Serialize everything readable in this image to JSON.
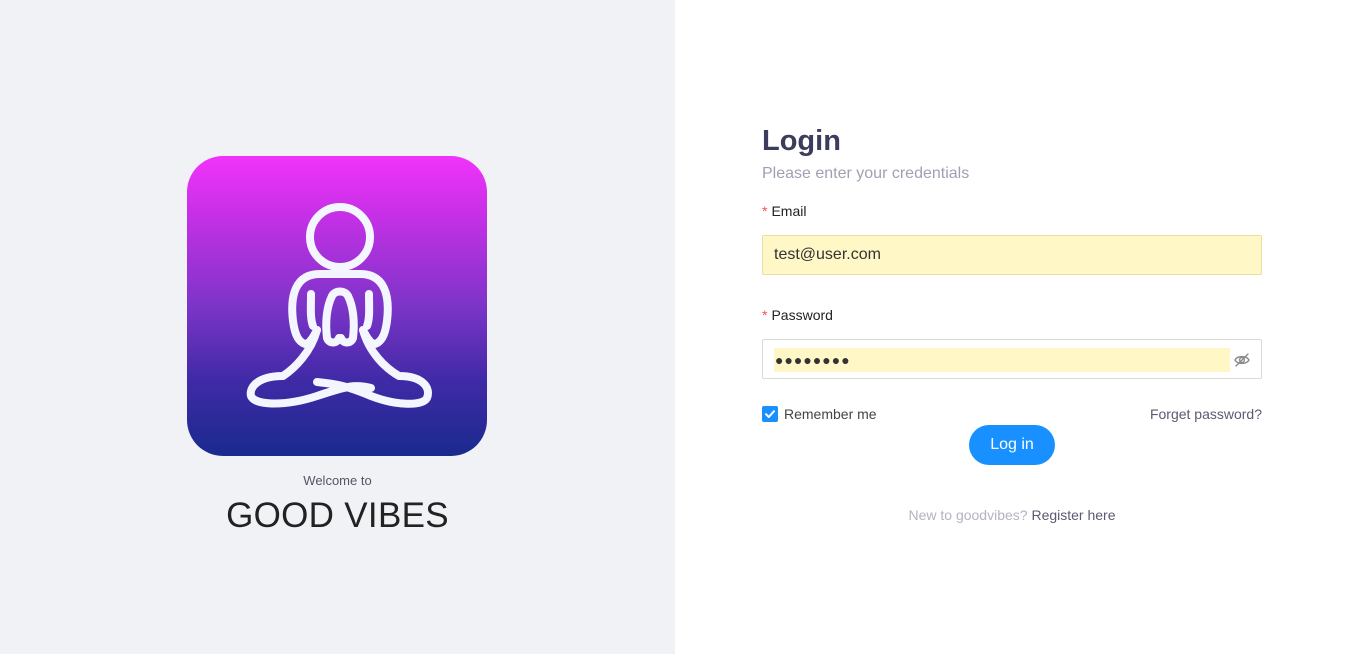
{
  "brand": {
    "welcome_text": "Welcome to",
    "name": "GOOD VIBES",
    "logo_icon": "meditation-figure-icon",
    "logo_gradient": [
      "#f233fb",
      "#1a2a8e"
    ]
  },
  "login": {
    "title": "Login",
    "subtitle": "Please enter your credentials",
    "email": {
      "label": "Email",
      "required_mark": "*",
      "value": "test@user.com"
    },
    "password": {
      "label": "Password",
      "required_mark": "*",
      "value": "●●●●●●●●",
      "toggle_icon": "eye-invisible-icon"
    },
    "remember_me": {
      "label": "Remember me",
      "checked": true
    },
    "forgot_password": "Forget password?",
    "submit_label": "Log in",
    "register_prompt": "New to goodvibes?",
    "register_link": "Register here"
  },
  "colors": {
    "primary": "#1890ff",
    "left_bg": "#f0f2f5",
    "title": "#3c3d5c",
    "required": "#ff4d4f",
    "autofill": "#fff8c6"
  }
}
